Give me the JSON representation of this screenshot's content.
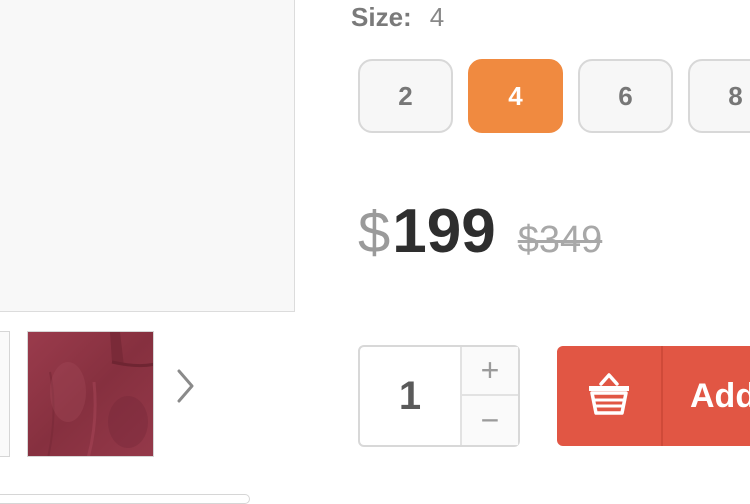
{
  "size": {
    "label": "Size:",
    "selected": "4",
    "options": [
      "2",
      "4",
      "6",
      "8"
    ]
  },
  "price": {
    "currency": "$",
    "current": "199",
    "original": "$349"
  },
  "quantity": {
    "value": "1",
    "increment": "+",
    "decrement": "−"
  },
  "cart": {
    "add_label": "Add"
  },
  "gallery": {
    "next_icon": "chevron-right-icon",
    "thumb_color": "#8d3444"
  },
  "colors": {
    "accent": "#f08a40",
    "cart_button": "#e15644"
  },
  "icons": {
    "cart": "basket-icon"
  }
}
